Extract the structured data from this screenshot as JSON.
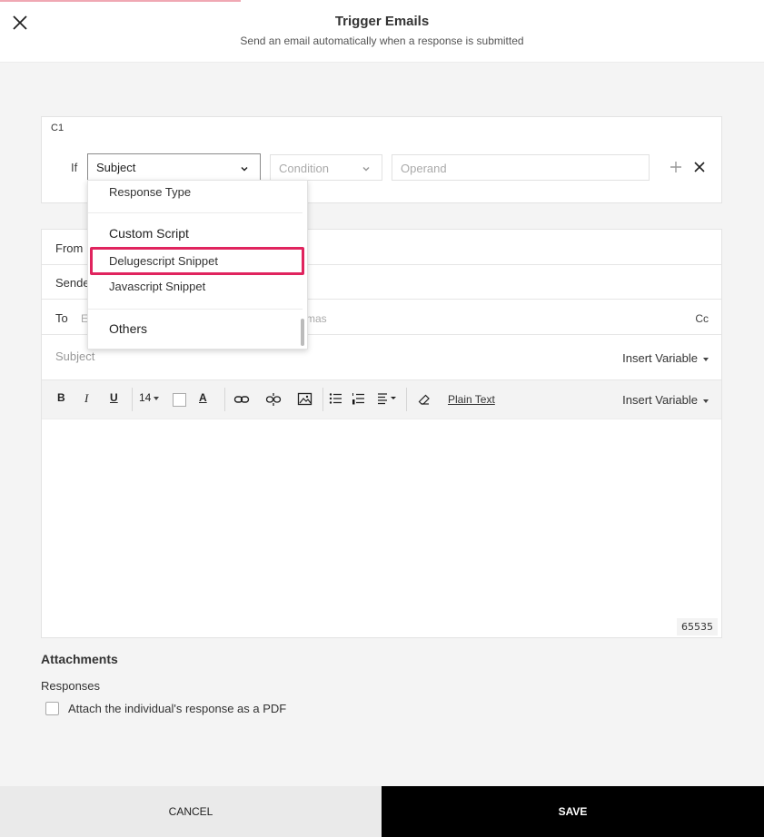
{
  "header": {
    "title": "Trigger Emails",
    "subtitle": "Send an email automatically when a response is submitted",
    "close_icon": "close-icon"
  },
  "condition": {
    "id": "C1",
    "if_label": "If",
    "field_value": "Subject",
    "condition_placeholder": "Condition",
    "operand_placeholder": "Operand"
  },
  "dropdown": {
    "items": [
      {
        "label": "Response Type",
        "kind": "item"
      },
      {
        "label": "Custom Script",
        "kind": "group"
      },
      {
        "label": "Delugescript Snippet",
        "kind": "item",
        "highlighted": true
      },
      {
        "label": "Javascript Snippet",
        "kind": "item"
      },
      {
        "label": "Others",
        "kind": "group"
      }
    ],
    "highlight_color": "#e0245e"
  },
  "email": {
    "from_label": "From",
    "sender_label": "Sende",
    "to_label": "To",
    "to_placeholder_start": "E",
    "to_placeholder_tail": "mas",
    "cc_label": "Cc",
    "subject_placeholder": "Subject",
    "insert_variable_label": "Insert Variable",
    "toolbar": {
      "bold": "B",
      "italic": "I",
      "underline": "U",
      "font_size": "14",
      "text_color_letter": "A",
      "plain_text": "Plain Text"
    },
    "char_count": "65535"
  },
  "attachments": {
    "title": "Attachments",
    "responses_label": "Responses",
    "pdf_option_label": "Attach the individual's response as a PDF",
    "pdf_checked": false
  },
  "footer": {
    "cancel_label": "CANCEL",
    "save_label": "SAVE"
  }
}
